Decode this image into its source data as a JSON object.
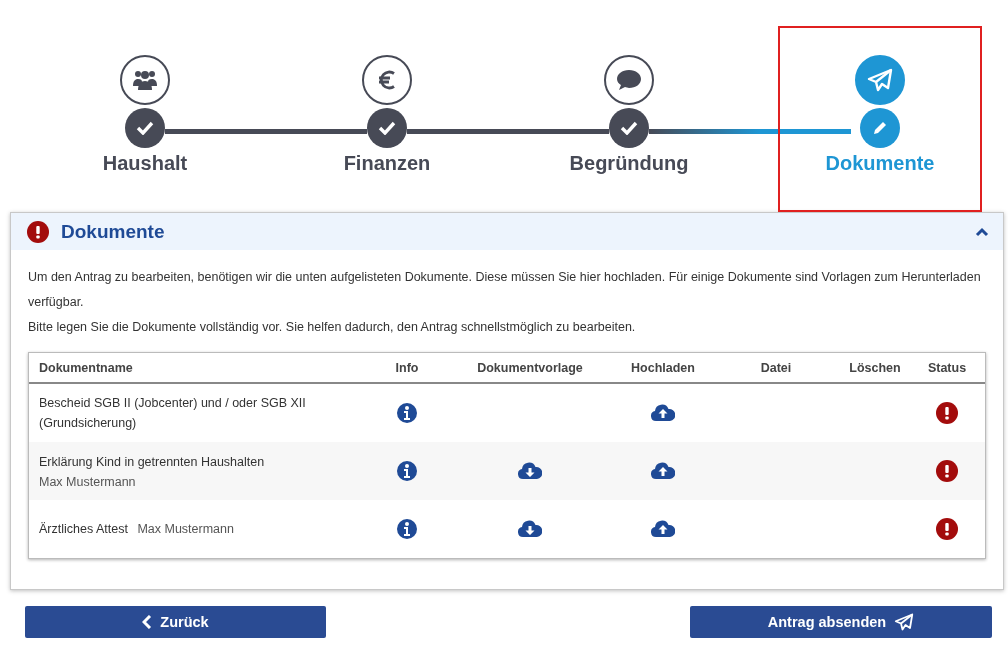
{
  "steps": [
    {
      "label": "Haushalt",
      "kind": "people",
      "completed": true,
      "selected": false,
      "highlighted": false
    },
    {
      "label": "Finanzen",
      "kind": "euro",
      "completed": true,
      "selected": false,
      "highlighted": false
    },
    {
      "label": "Begründung",
      "kind": "comment",
      "completed": true,
      "selected": false,
      "highlighted": false
    },
    {
      "label": "Dokumente",
      "kind": "plane",
      "completed": false,
      "selected": true,
      "highlighted": true
    }
  ],
  "panel": {
    "title": "Dokumente",
    "missing": true,
    "expanded": true,
    "paragraphs": [
      "Um den Antrag zu bearbeiten, benötigen wir die unten aufgelisteten Dokumente. Diese müssen Sie hier hochladen. Für einige Dokumente sind Vorlagen zum Herunterladen verfügbar.",
      "Bitte legen Sie die Dokumente vollständig vor. Sie helfen dadurch, den Antrag schnellstmöglich zu bearbeiten."
    ],
    "table": {
      "columns": [
        "Dokumentname",
        "Info",
        "Dokumentvorlage",
        "Hochladen",
        "Datei",
        "Löschen",
        "Status"
      ],
      "rows": [
        {
          "name": "Bescheid SGB II (Jobcenter) und / oder SGB XII (Grundsicherung)",
          "template": false,
          "missing": true
        },
        {
          "name": "Erklärung Kind in getrennten Haushalten",
          "person": "Max Mustermann",
          "person_inline": false,
          "template": true,
          "missing": true
        },
        {
          "name": "Ärztliches Attest",
          "person": "Max Mustermann",
          "person_inline": true,
          "template": true,
          "missing": true
        }
      ]
    }
  },
  "buttons": {
    "back": "Zurück",
    "submit": "Antrag absenden"
  }
}
